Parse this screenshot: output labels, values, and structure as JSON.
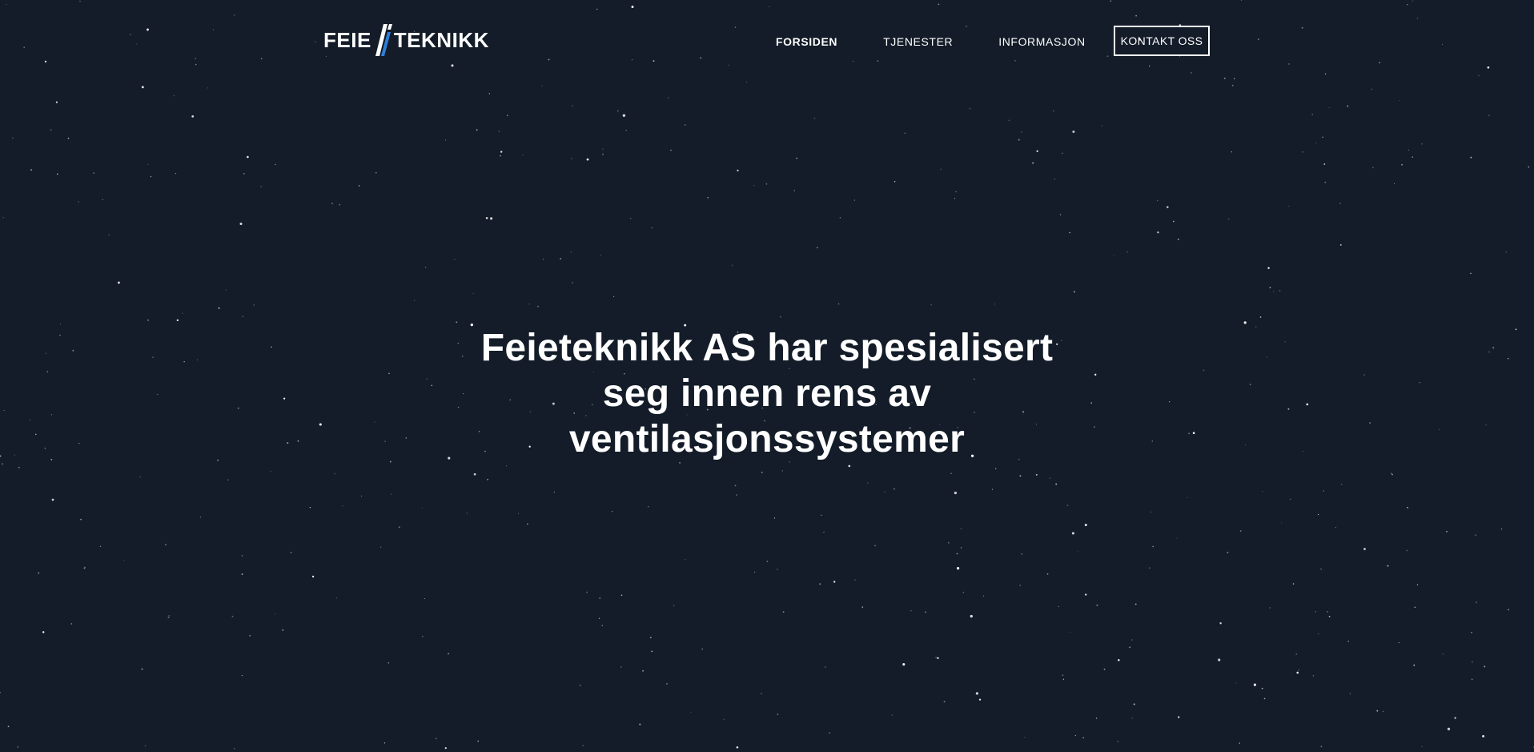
{
  "colors": {
    "background": "#131c28",
    "text": "#ffffff",
    "logo_accent": "#2d7fd8",
    "star": "#ffffff"
  },
  "header": {
    "logo": {
      "left_word": "FEIE",
      "right_word": "TEKNIKK",
      "mark_icon": "double-slash-icon"
    },
    "nav": {
      "items": [
        {
          "label": "FORSIDEN",
          "active": true
        },
        {
          "label": "TJENESTER",
          "active": false
        },
        {
          "label": "INFORMASJON",
          "active": false
        }
      ]
    },
    "cta_label": "KONTAKT OSS"
  },
  "hero": {
    "title": "Feieteknikk AS har spesialisert seg innen rens av ventilasjonssystemer"
  },
  "background_icon": "starfield"
}
